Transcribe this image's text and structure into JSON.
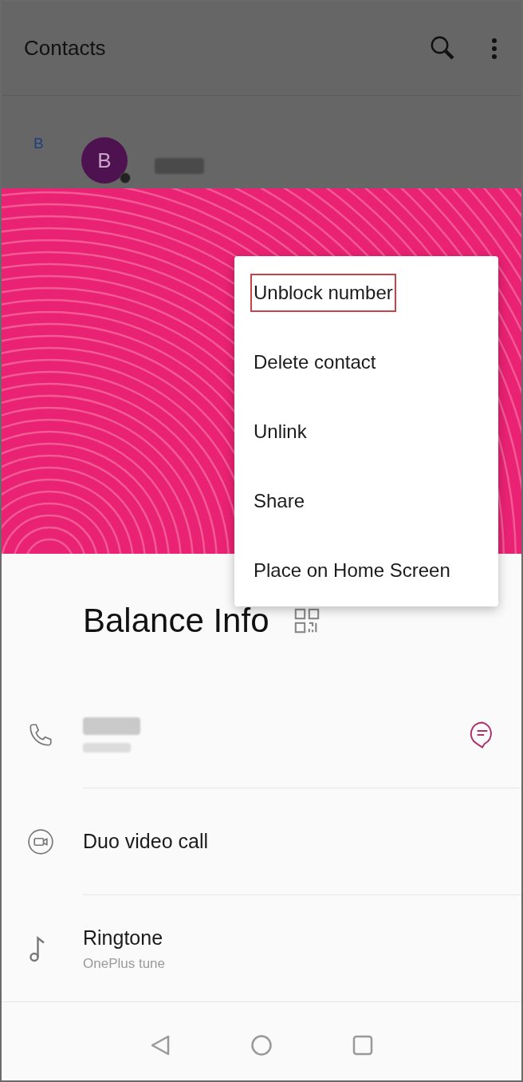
{
  "app_bar": {
    "title": "Contacts"
  },
  "contact_list": {
    "section_letter": "B",
    "avatar_letter": "B"
  },
  "menu": {
    "items": [
      {
        "label": "Unblock number",
        "highlighted": true
      },
      {
        "label": "Delete contact",
        "highlighted": false
      },
      {
        "label": "Unlink",
        "highlighted": false
      },
      {
        "label": "Share",
        "highlighted": false
      },
      {
        "label": "Place on Home Screen",
        "highlighted": false
      }
    ]
  },
  "contact": {
    "name": "Balance Info"
  },
  "rows": [
    {
      "kind": "phone"
    },
    {
      "kind": "video",
      "title": "Duo video call"
    },
    {
      "kind": "ringtone",
      "title": "Ringtone",
      "subtitle": "OnePlus tune"
    }
  ]
}
